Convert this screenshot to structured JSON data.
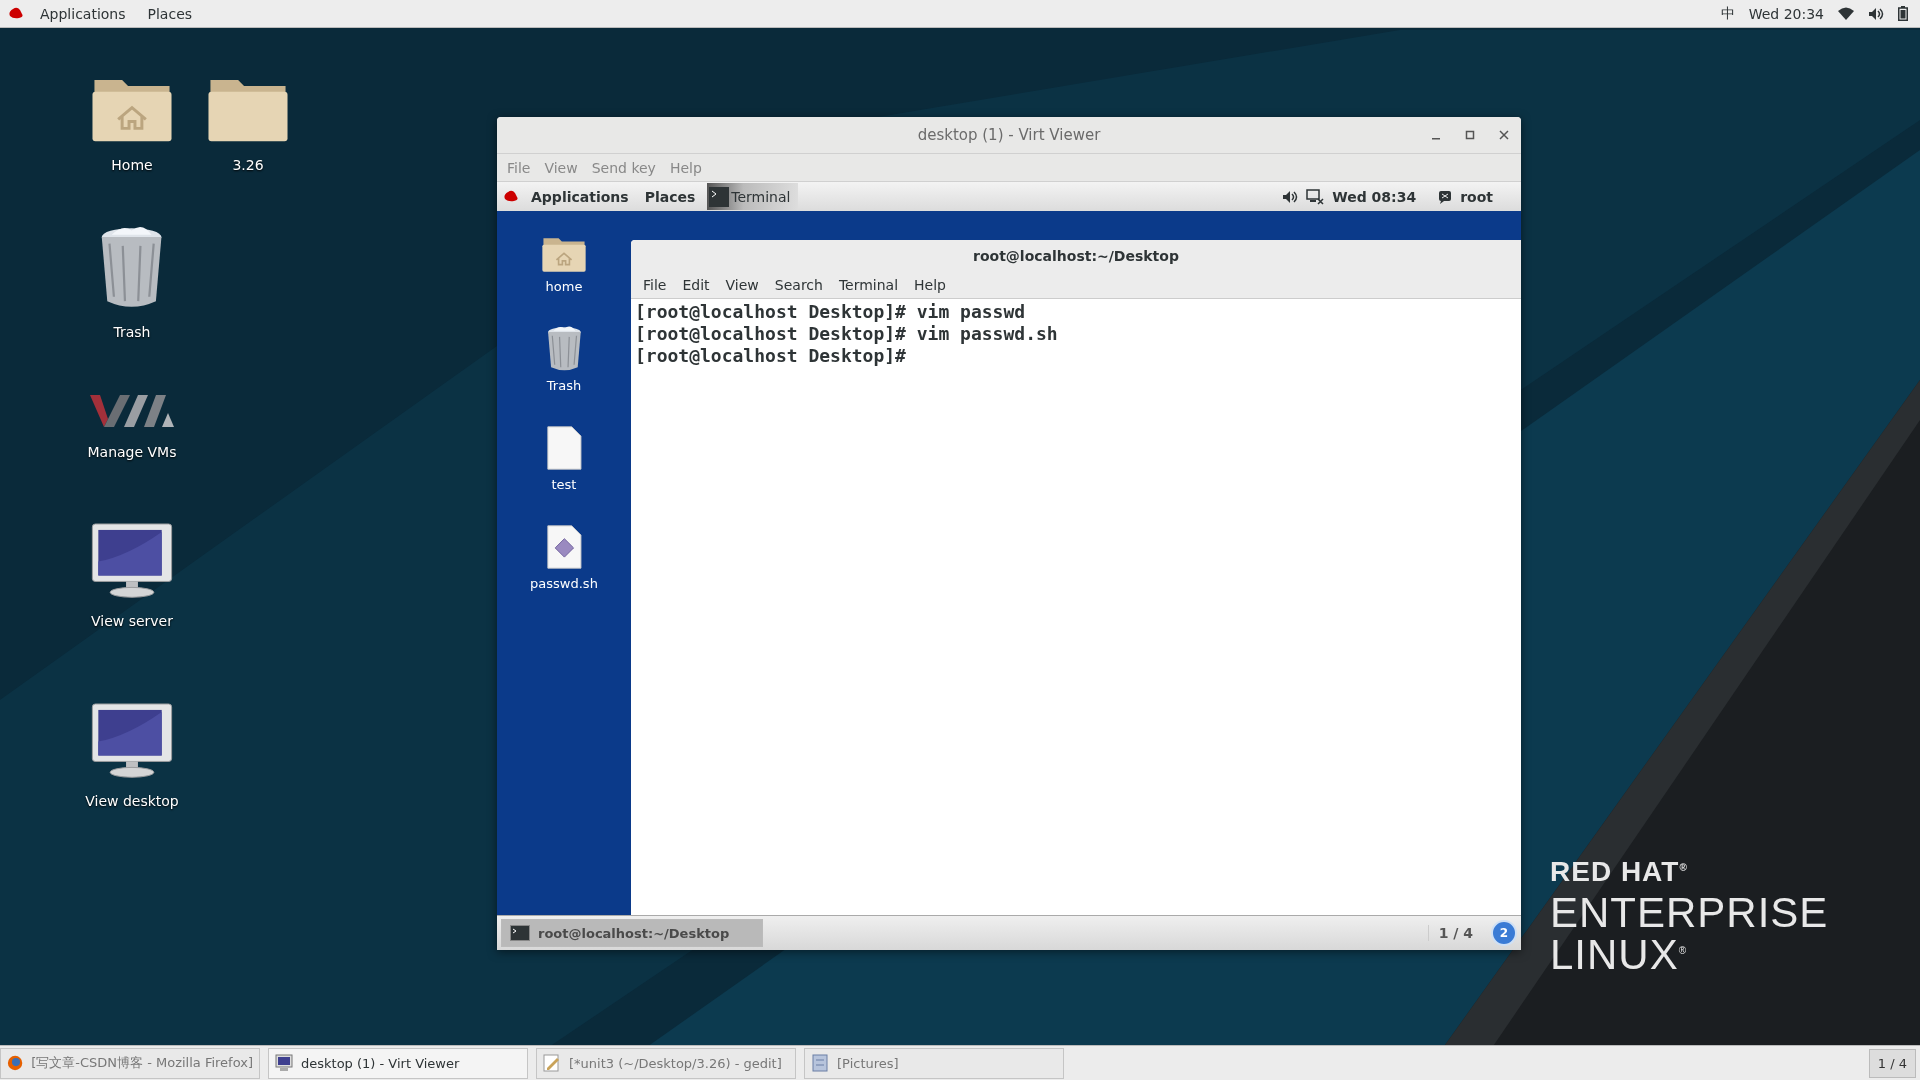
{
  "top_bar": {
    "menus": [
      "Applications",
      "Places"
    ],
    "input_method": "中",
    "clock": "Wed 20:34"
  },
  "desktop_icons": [
    {
      "label": "Home",
      "kind": "home-folder"
    },
    {
      "label": "3.26",
      "kind": "folder"
    },
    {
      "label": "Trash",
      "kind": "trash"
    },
    {
      "label": "Manage VMs",
      "kind": "vm"
    },
    {
      "label": "View server",
      "kind": "monitor"
    },
    {
      "label": "View desktop",
      "kind": "monitor"
    }
  ],
  "viewer_window": {
    "title": "desktop (1) - Virt Viewer",
    "menus": [
      "File",
      "View",
      "Send key",
      "Help"
    ],
    "guest": {
      "top_bar": {
        "menus": [
          "Applications",
          "Places"
        ],
        "task": "Terminal",
        "clock": "Wed 08:34",
        "user": "root"
      },
      "desktop_icons": [
        {
          "label": "home",
          "kind": "home-folder"
        },
        {
          "label": "Trash",
          "kind": "trash"
        },
        {
          "label": "test",
          "kind": "file"
        },
        {
          "label": "passwd.sh",
          "kind": "script"
        }
      ],
      "terminal": {
        "title": "root@localhost:~/Desktop",
        "menus": [
          "File",
          "Edit",
          "View",
          "Search",
          "Terminal",
          "Help"
        ],
        "lines": [
          "[root@localhost Desktop]# vim passwd",
          "[root@localhost Desktop]# vim passwd.sh",
          "[root@localhost Desktop]#"
        ]
      },
      "taskbar": {
        "tasks": [
          {
            "label": "root@localhost:~/Desktop",
            "selected": true
          }
        ],
        "workspace": "1 / 4",
        "badge": "2"
      }
    }
  },
  "logo": {
    "lines": [
      "RED HAT$^{®}$",
      "ENTERPRISE",
      "LINUX$^{®}$"
    ]
  },
  "taskbar": {
    "tasks": [
      {
        "label": "[写文章-CSDN博客 - Mozilla Firefox]",
        "kind": "browser",
        "selected": false
      },
      {
        "label": "desktop (1) - Virt Viewer",
        "kind": "viewer",
        "selected": true
      },
      {
        "label": "[*unit3 (~/Desktop/3.26) - gedit]",
        "kind": "editor",
        "selected": false
      },
      {
        "label": "[Pictures]",
        "kind": "files",
        "selected": false
      }
    ],
    "workspace": "1 / 4"
  }
}
